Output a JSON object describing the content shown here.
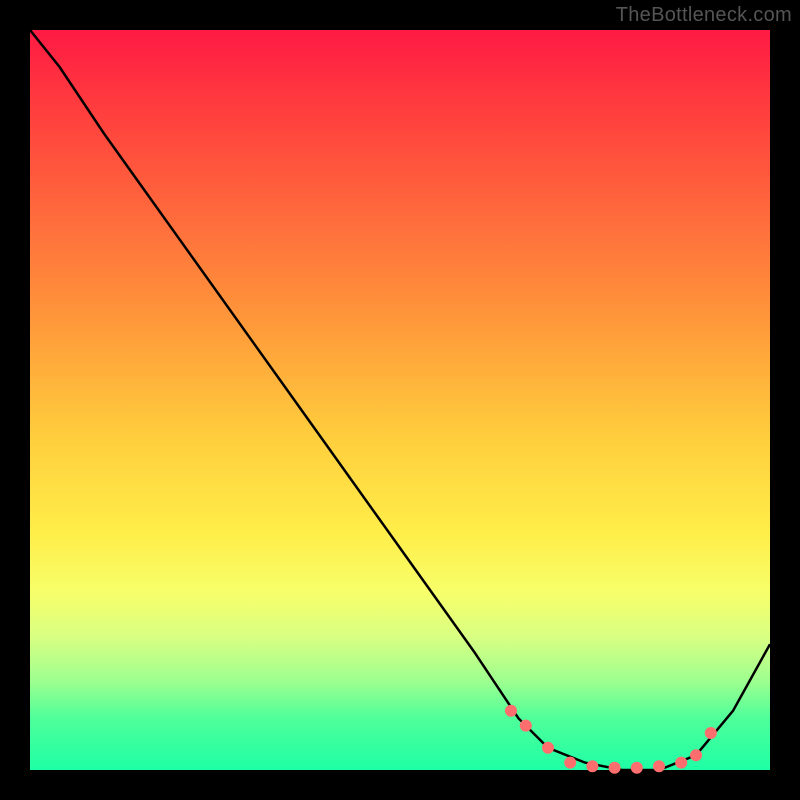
{
  "watermark": "TheBottleneck.com",
  "chart_data": {
    "type": "line",
    "title": "",
    "xlabel": "",
    "ylabel": "",
    "xlim": [
      0,
      100
    ],
    "ylim": [
      0,
      100
    ],
    "grid": false,
    "series": [
      {
        "name": "bottleneck-curve",
        "x": [
          0,
          4,
          10,
          20,
          30,
          40,
          50,
          60,
          66,
          70,
          75,
          80,
          85,
          90,
          95,
          100
        ],
        "y": [
          100,
          95,
          86,
          72,
          58,
          44,
          30,
          16,
          7,
          3,
          1,
          0,
          0,
          2,
          8,
          17
        ]
      }
    ],
    "markers": {
      "name": "highlight-points",
      "color": "#ff6e6e",
      "radius": 6,
      "x": [
        65,
        67,
        70,
        73,
        76,
        79,
        82,
        85,
        88,
        90,
        92
      ],
      "y": [
        8,
        6,
        3,
        1,
        0.5,
        0.3,
        0.3,
        0.5,
        1,
        2,
        5
      ]
    },
    "gradient_stops": [
      {
        "offset": 0,
        "color": "#ff1a44"
      },
      {
        "offset": 10,
        "color": "#ff3b3e"
      },
      {
        "offset": 25,
        "color": "#ff6a3c"
      },
      {
        "offset": 40,
        "color": "#ff9a3a"
      },
      {
        "offset": 55,
        "color": "#ffce3d"
      },
      {
        "offset": 68,
        "color": "#ffee49"
      },
      {
        "offset": 76,
        "color": "#f7ff6a"
      },
      {
        "offset": 82,
        "color": "#d9ff82"
      },
      {
        "offset": 88,
        "color": "#9dff8f"
      },
      {
        "offset": 93,
        "color": "#4fff9a"
      },
      {
        "offset": 100,
        "color": "#1effa5"
      }
    ]
  }
}
